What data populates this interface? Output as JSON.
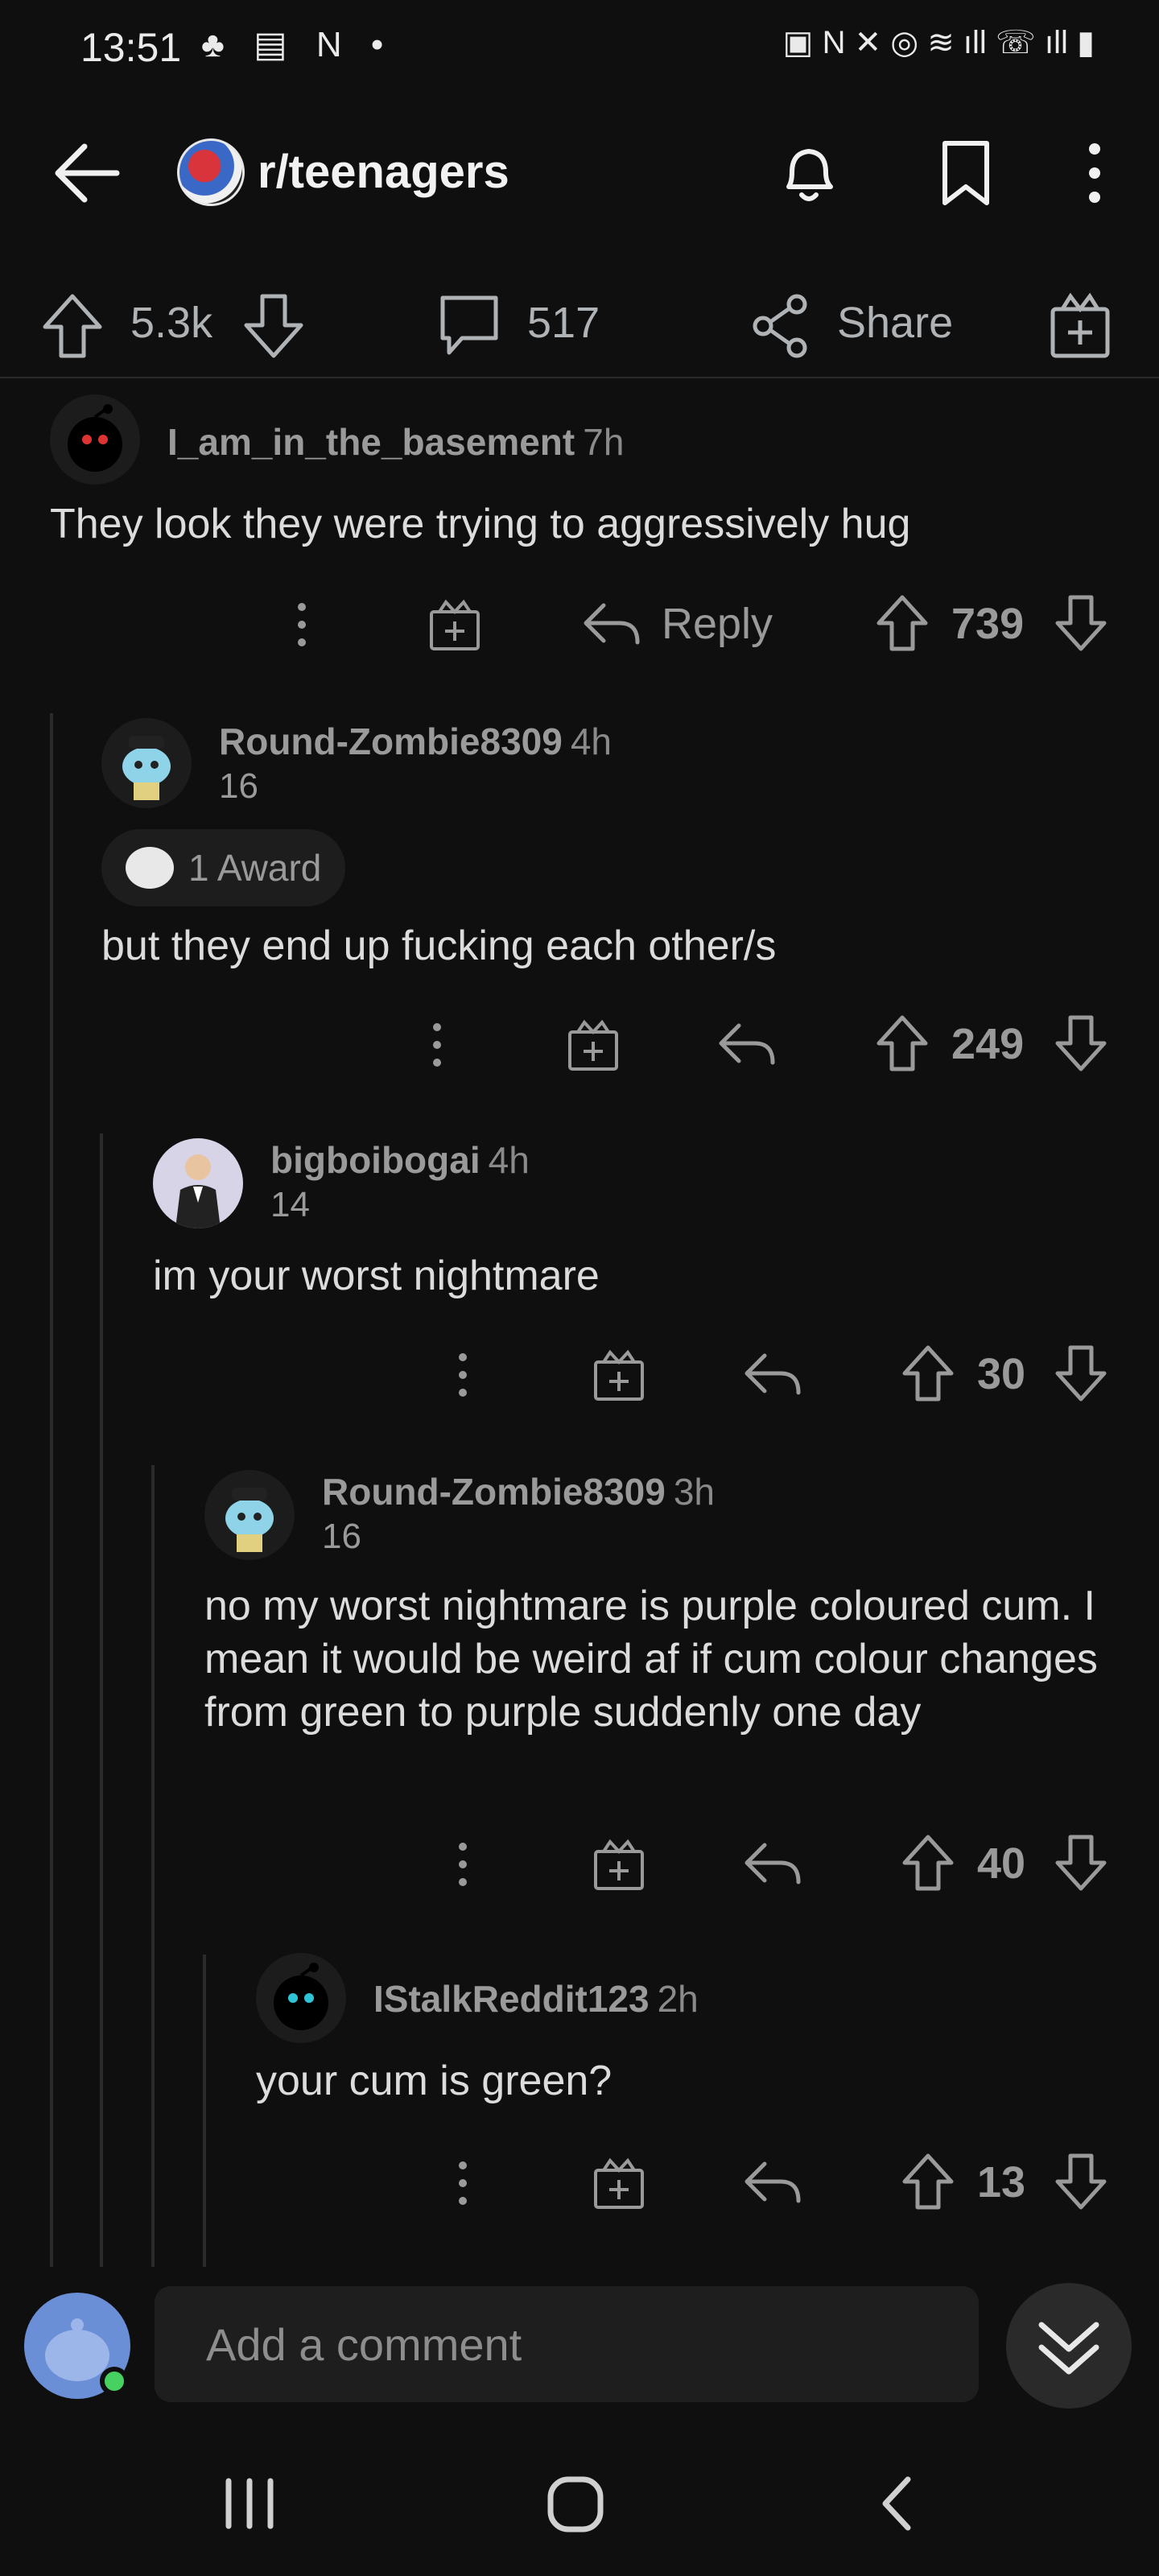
{
  "status": {
    "time": "13:51",
    "left_icons": "♣ ▤ N •",
    "right_icons": "▣ N ✕ ◎ ≋ ıll ☏ ıll ▮"
  },
  "appbar": {
    "subreddit": "r/teenagers",
    "icons": [
      "back-arrow-icon",
      "bell-icon",
      "bookmark-icon",
      "kebab-icon"
    ]
  },
  "post_actions": {
    "upvotes": "5.3k",
    "comments": "517",
    "share": "Share"
  },
  "comments": [
    {
      "user": "I_am_in_the_basement",
      "time": "7h",
      "flair": "",
      "award": "",
      "body": "They look they were trying to aggressively hug",
      "score": "739",
      "reply_label": "Reply"
    },
    {
      "user": "Round-Zombie8309",
      "time": "4h",
      "flair": "16",
      "award": "1 Award",
      "body": "but they end up fucking each other/s",
      "score": "249"
    },
    {
      "user": "bigboibogai",
      "time": "4h",
      "flair": "14",
      "award": "",
      "body": "im your worst nightmare",
      "score": "30"
    },
    {
      "user": "Round-Zombie8309",
      "time": "3h",
      "flair": "16",
      "award": "",
      "body": "no my worst nightmare is purple coloured cum. I mean it would be weird af if cum colour changes from green to purple suddenly one day",
      "score": "40"
    },
    {
      "user": "IStalkReddit123",
      "time": "2h",
      "flair": "",
      "award": "",
      "body": "your cum is green?",
      "score": "13"
    }
  ],
  "compose": {
    "placeholder": "Add a comment"
  },
  "colors": {
    "background": "#0f0f0f",
    "online": "#46d160",
    "muted_text": "#9a9a9a"
  }
}
